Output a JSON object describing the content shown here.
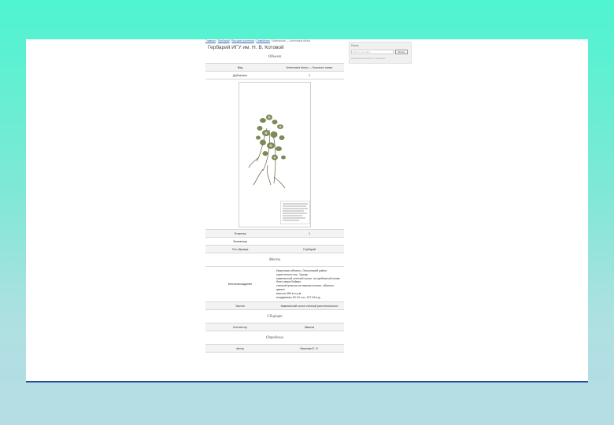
{
  "breadcrumb": {
    "items": [
      "Главная",
      "Гербарий",
      "Высшие растения",
      "Семейство"
    ],
    "current": "Asteraceae — Antennaria dioica"
  },
  "page_title": "Гербарий ИГУ им. Н. В. Котовой",
  "search": {
    "label": "Поиск",
    "placeholder": "Искать на сайте",
    "button": "Искать",
    "note": "Расширенный поиск по гербарию"
  },
  "sections": {
    "object": "Объект",
    "place": "Место",
    "collector": "Сборщик",
    "det": "Определил"
  },
  "object_rows": [
    {
      "label": "Вид",
      "value": "Antennaria dioica — Кошачья лапка"
    },
    {
      "label": "Дубликаты",
      "value": "1"
    }
  ],
  "sheet_rows": [
    {
      "label": "Этикетка",
      "value": "1"
    },
    {
      "label": "Экземпляр",
      "value": ""
    },
    {
      "label": "Тип образца",
      "value": "Гербарий"
    }
  ],
  "locality": {
    "label": "Местонахождение",
    "lines": [
      "Иркутская область, Ольхонский район",
      "окрестности пос. Хужир",
      "каменистый степной склон, на щебнистой почве",
      "близ озера Байкал",
      "степной участок на южном склоне, обильно цветет",
      "высота 450 м н.у.м.",
      "координаты 53.19 с.ш. 107.34 в.д."
    ]
  },
  "habitat": {
    "label": "Экотоп",
    "value": "Каменистый склон степной растительности"
  },
  "collector_row": {
    "label": "Коллектор",
    "value": "Иванов"
  },
  "det_row": {
    "label": "Автор",
    "value": "Иванова Е. Н."
  },
  "colors": {
    "accent": "#3a5fb0",
    "border": "#2a4aa0"
  }
}
